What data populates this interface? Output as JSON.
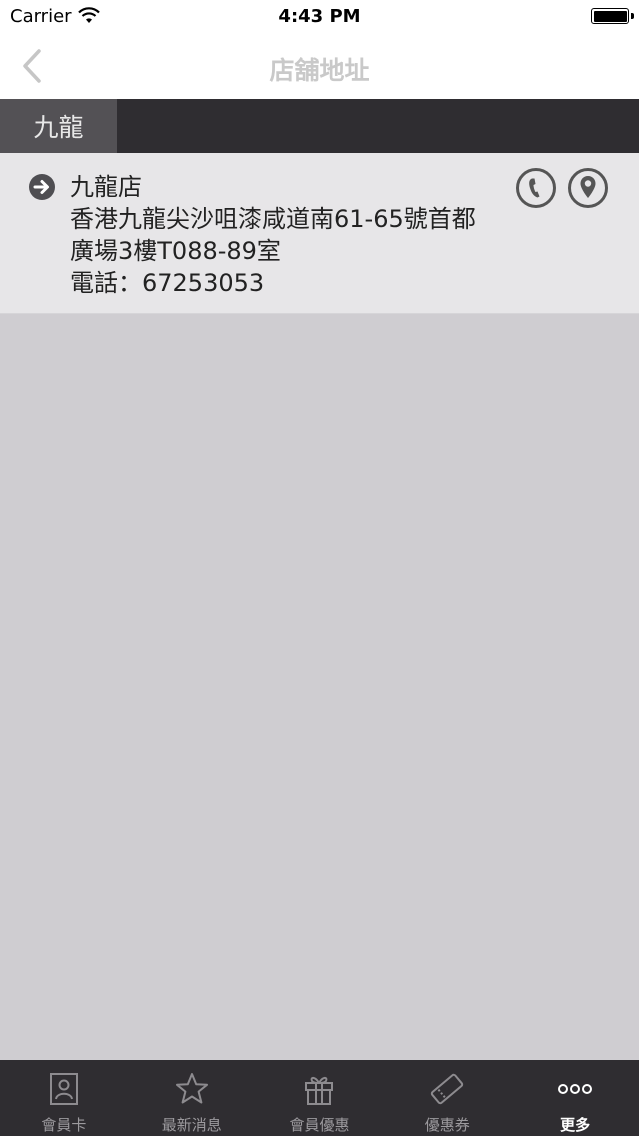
{
  "status_bar": {
    "carrier": "Carrier",
    "time": "4:43 PM"
  },
  "nav": {
    "title": "店舖地址",
    "back_icon": "chevron-left-icon"
  },
  "region_tabs": [
    {
      "label": "九龍",
      "selected": true
    }
  ],
  "stores": [
    {
      "name": "九龍店",
      "address_line1": "香港九龍尖沙咀漆咸道南61-65號首都",
      "address_line2": "廣場3樓T088-89室",
      "phone": "電話：67253053"
    }
  ],
  "tabs": [
    {
      "label": "會員卡",
      "icon": "member-card-icon"
    },
    {
      "label": "最新消息",
      "icon": "star-icon"
    },
    {
      "label": "會員優惠",
      "icon": "gift-icon"
    },
    {
      "label": "優惠券",
      "icon": "coupon-icon"
    },
    {
      "label": "更多",
      "icon": "more-icon",
      "active": true
    }
  ],
  "colors": {
    "tab_bar": "#2f2d31",
    "card": "#e7e6e8",
    "background": "#cfcdd1",
    "accent_icon": "#555555"
  }
}
